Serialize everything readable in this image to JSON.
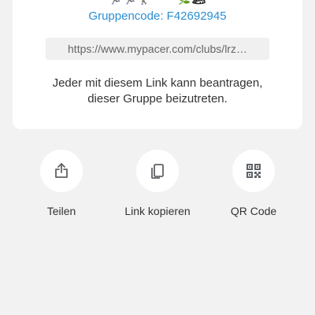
{
  "card": {
    "group_code": "Gruppencode: F42692945",
    "link": "https://www.mypacer.com/clubs/lrz…",
    "info_line1": "Jeder mit diesem Link kann beantragen,",
    "info_line2": "dieser Gruppe beizutreten."
  },
  "actions": {
    "share": {
      "label": "Teilen",
      "icon": "share-icon"
    },
    "copy": {
      "label": "Link kopieren",
      "icon": "copy-icon"
    },
    "qr": {
      "label": "QR Code",
      "icon": "qr-code-icon"
    }
  },
  "colors": {
    "accent": "#2b8ed3",
    "background": "#f2f2f2",
    "card": "#ffffff"
  }
}
